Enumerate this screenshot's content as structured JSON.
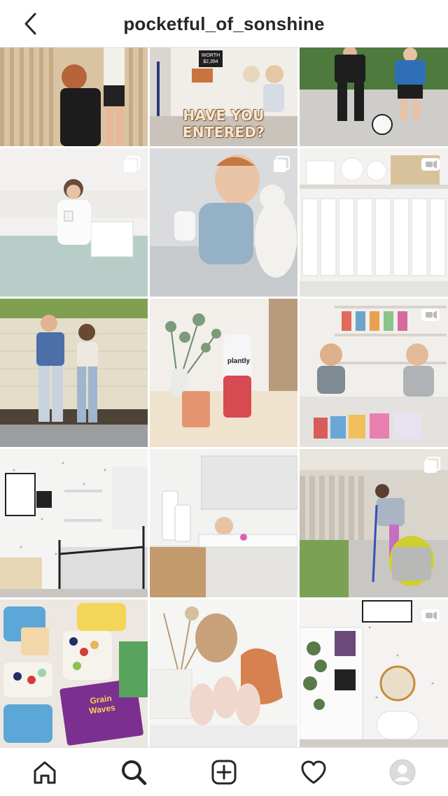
{
  "header": {
    "title": "pocketful_of_sonshine",
    "back_icon": "chevron-left-icon"
  },
  "posts": [
    {
      "description": "boy jumping for basketball",
      "badge": null
    },
    {
      "description": "toddler with dog, giveaway promo",
      "badge": null,
      "sign_line1": "WORTH",
      "sign_line2": "$2,394",
      "overlay_text": "HAVE YOU ENTERED?"
    },
    {
      "description": "two boys playing soccer",
      "badge": null
    },
    {
      "description": "woman in robe on bed",
      "badge": "carousel-icon"
    },
    {
      "description": "smiling toddler with bottle",
      "badge": "carousel-icon"
    },
    {
      "description": "white shelf with binders",
      "badge": "video-icon"
    },
    {
      "description": "couple posing by wall",
      "badge": null
    },
    {
      "description": "drink bottle with eucalyptus",
      "badge": null,
      "product_label": "plantly"
    },
    {
      "description": "kids reading books on rug",
      "badge": "video-icon"
    },
    {
      "description": "kids bedroom with starry wallpaper",
      "badge": null
    },
    {
      "description": "child in bath",
      "badge": null
    },
    {
      "description": "woman vacuuming with wet-dry vac",
      "badge": "carousel-icon"
    },
    {
      "description": "lunchboxes with snacks",
      "badge": null,
      "product_label": "Grain Waves"
    },
    {
      "description": "vases and body candles",
      "badge": null
    },
    {
      "description": "bookshelf and globe",
      "badge": "video-icon"
    }
  ],
  "nav": {
    "items": [
      {
        "icon": "home-icon",
        "active": false
      },
      {
        "icon": "search-icon",
        "active": true
      },
      {
        "icon": "add-post-icon",
        "active": false
      },
      {
        "icon": "heart-icon",
        "active": false
      },
      {
        "icon": "profile-avatar-icon",
        "active": false
      }
    ]
  },
  "colors": {
    "text": "#262626",
    "divider": "#dbdbdb",
    "background": "#ffffff"
  }
}
